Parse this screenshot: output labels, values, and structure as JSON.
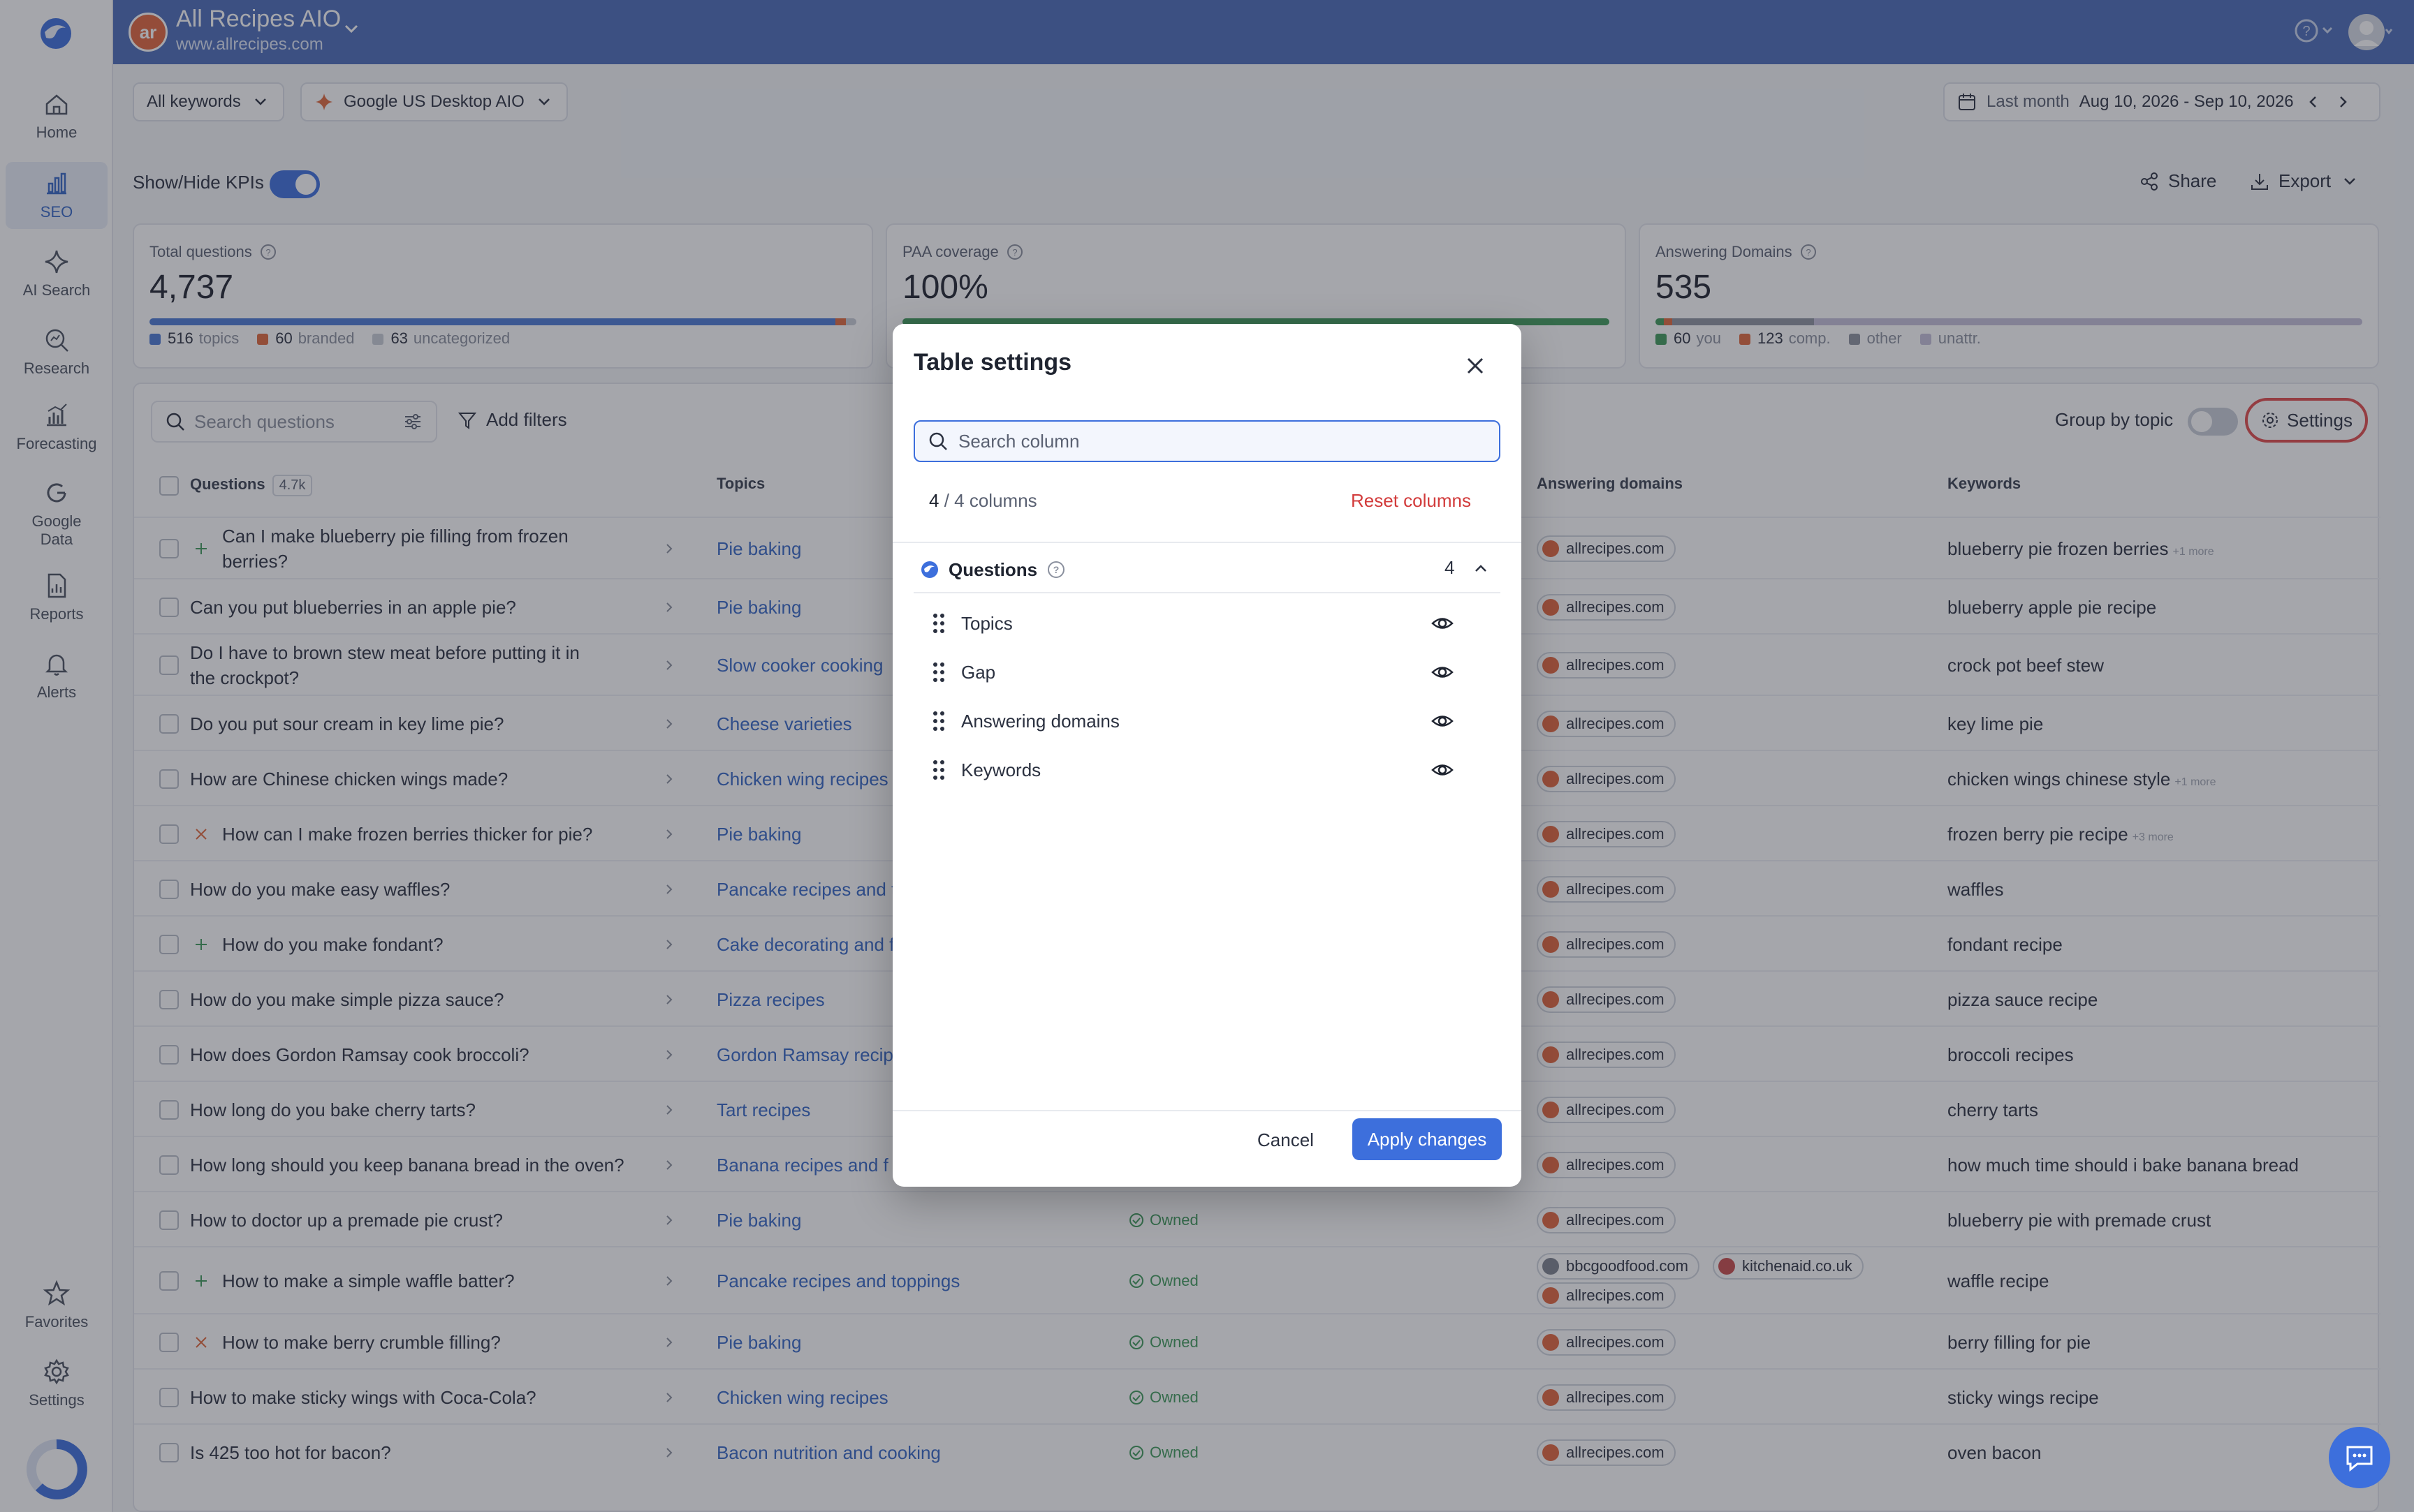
{
  "sidebar": {
    "items": [
      {
        "label": "Home",
        "icon": "home-icon"
      },
      {
        "label": "SEO",
        "icon": "bar-chart-icon"
      },
      {
        "label": "AI Search",
        "icon": "sparkle-icon"
      },
      {
        "label": "Research",
        "icon": "search-chart-icon"
      },
      {
        "label": "Forecasting",
        "icon": "forecast-icon"
      },
      {
        "label": "Google Data",
        "icon": "google-icon"
      },
      {
        "label": "Reports",
        "icon": "report-icon"
      },
      {
        "label": "Alerts",
        "icon": "bell-icon"
      }
    ],
    "bottom_items": [
      {
        "label": "Favorites",
        "icon": "star-icon"
      },
      {
        "label": "Settings",
        "icon": "gear-icon"
      }
    ]
  },
  "header": {
    "site_initials": "ar",
    "site_name": "All Recipes AIO",
    "site_url": "www.allrecipes.com"
  },
  "filters": {
    "keywords": "All keywords",
    "engine": "Google US Desktop AIO",
    "date_preset": "Last month",
    "date_range": "Aug 10, 2026 - Sep 10, 2026"
  },
  "toolbar": {
    "kpi_toggle_label": "Show/Hide KPIs",
    "share_label": "Share",
    "export_label": "Export"
  },
  "kpis": [
    {
      "label": "Total questions",
      "value": "4,737",
      "legend": [
        {
          "count": "516",
          "label": "topics",
          "color": "#4a79d4"
        },
        {
          "count": "60",
          "label": "branded",
          "color": "#e0683c"
        },
        {
          "count": "63",
          "label": "uncategorized",
          "color": "#c9cdd6"
        }
      ],
      "bar": [
        0.97,
        0.015,
        0.015
      ]
    },
    {
      "label": "PAA coverage",
      "value": "100%",
      "legend": [],
      "bar": [
        1.0
      ],
      "bar_color": "#3e9a5b"
    },
    {
      "label": "Answering Domains",
      "value": "535",
      "legend": [
        {
          "count": "60",
          "label": "you",
          "color": "#3e9a5b"
        },
        {
          "count": "123",
          "label": "comp.",
          "color": "#e0683c"
        },
        {
          "count": "",
          "label": "other",
          "color": "#8e939f"
        },
        {
          "count": "",
          "label": "unattr.",
          "color": "#c4c0da"
        }
      ],
      "bar": [
        0.012,
        0.012,
        0.2,
        0.776
      ]
    }
  ],
  "table": {
    "search_placeholder": "Search questions",
    "add_filters_label": "Add filters",
    "group_by_label": "Group by topic",
    "settings_label": "Settings",
    "headers": {
      "questions": "Questions",
      "questions_count": "4.7k",
      "topics": "Topics",
      "answering_domains": "Answering domains",
      "keywords": "Keywords"
    },
    "rows": [
      {
        "q": "Can I make blueberry pie filling from frozen berries?",
        "gap": "plus",
        "topic": "Pie baking",
        "owned": "",
        "domains": [
          "allrecipes.com"
        ],
        "kw": "blueberry pie frozen berries",
        "more": "+1 more"
      },
      {
        "q": "Can you put blueberries in an apple pie?",
        "gap": "",
        "topic": "Pie baking",
        "owned": "",
        "domains": [
          "allrecipes.com"
        ],
        "kw": "blueberry apple pie recipe",
        "more": ""
      },
      {
        "q": "Do I have to brown stew meat before putting it in the crockpot?",
        "gap": "",
        "topic": "Slow cooker cooking",
        "owned": "",
        "domains": [
          "allrecipes.com"
        ],
        "kw": "crock pot beef stew",
        "more": ""
      },
      {
        "q": "Do you put sour cream in key lime pie?",
        "gap": "",
        "topic": "Cheese varieties",
        "owned": "",
        "domains": [
          "allrecipes.com"
        ],
        "kw": "key lime pie",
        "more": ""
      },
      {
        "q": "How are Chinese chicken wings made?",
        "gap": "",
        "topic": "Chicken wing recipes",
        "owned": "",
        "domains": [
          "allrecipes.com"
        ],
        "kw": "chicken wings chinese style",
        "more": "+1 more"
      },
      {
        "q": "How can I make frozen berries thicker for pie?",
        "gap": "x",
        "topic": "Pie baking",
        "owned": "",
        "domains": [
          "allrecipes.com"
        ],
        "kw": "frozen berry pie recipe",
        "more": "+3 more"
      },
      {
        "q": "How do you make easy waffles?",
        "gap": "",
        "topic": "Pancake recipes and t",
        "owned": "",
        "domains": [
          "allrecipes.com"
        ],
        "kw": "waffles",
        "more": ""
      },
      {
        "q": "How do you make fondant?",
        "gap": "plus",
        "topic": "Cake decorating and f",
        "owned": "",
        "domains": [
          "allrecipes.com"
        ],
        "kw": "fondant recipe",
        "more": ""
      },
      {
        "q": "How do you make simple pizza sauce?",
        "gap": "",
        "topic": "Pizza recipes",
        "owned": "",
        "domains": [
          "allrecipes.com"
        ],
        "kw": "pizza sauce recipe",
        "more": ""
      },
      {
        "q": "How does Gordon Ramsay cook broccoli?",
        "gap": "",
        "topic": "Gordon Ramsay recip",
        "owned": "",
        "domains": [
          "allrecipes.com"
        ],
        "kw": "broccoli recipes",
        "more": ""
      },
      {
        "q": "How long do you bake cherry tarts?",
        "gap": "",
        "topic": "Tart recipes",
        "owned": "",
        "domains": [
          "allrecipes.com"
        ],
        "kw": "cherry tarts",
        "more": ""
      },
      {
        "q": "How long should you keep banana bread in the oven?",
        "gap": "",
        "topic": "Banana recipes and f",
        "owned": "",
        "domains": [
          "allrecipes.com"
        ],
        "kw": "how much time should i bake banana bread",
        "more": ""
      },
      {
        "q": "How to doctor up a premade pie crust?",
        "gap": "",
        "topic": "Pie baking",
        "owned": "Owned",
        "domains": [
          "allrecipes.com"
        ],
        "kw": "blueberry pie with premade crust",
        "more": ""
      },
      {
        "q": "How to make a simple waffle batter?",
        "gap": "plus",
        "topic": "Pancake recipes and toppings",
        "owned": "Owned",
        "domains": [
          "bbcgoodfood.com",
          "kitchenaid.co.uk",
          "allrecipes.com"
        ],
        "kw": "waffle recipe",
        "more": ""
      },
      {
        "q": "How to make berry crumble filling?",
        "gap": "x",
        "topic": "Pie baking",
        "owned": "Owned",
        "domains": [
          "allrecipes.com"
        ],
        "kw": "berry filling for pie",
        "more": ""
      },
      {
        "q": "How to make sticky wings with Coca-Cola?",
        "gap": "",
        "topic": "Chicken wing recipes",
        "owned": "Owned",
        "domains": [
          "allrecipes.com"
        ],
        "kw": "sticky wings recipe",
        "more": ""
      },
      {
        "q": "Is 425 too hot for bacon?",
        "gap": "",
        "topic": "Bacon nutrition and cooking",
        "owned": "Owned",
        "domains": [
          "allrecipes.com"
        ],
        "kw": "oven bacon",
        "more": ""
      }
    ]
  },
  "modal": {
    "title": "Table settings",
    "search_placeholder": "Search column",
    "count_shown": "4",
    "count_suffix": "/ 4 columns",
    "reset_label": "Reset columns",
    "group_label": "Questions",
    "group_count": "4",
    "columns": [
      "Topics",
      "Gap",
      "Answering domains",
      "Keywords"
    ],
    "cancel_label": "Cancel",
    "apply_label": "Apply changes"
  },
  "colors": {
    "brand_blue": "#4a6bb8",
    "accent": "#3d6fdc",
    "danger": "#d23b3b",
    "owned_green": "#3e9a5b"
  }
}
